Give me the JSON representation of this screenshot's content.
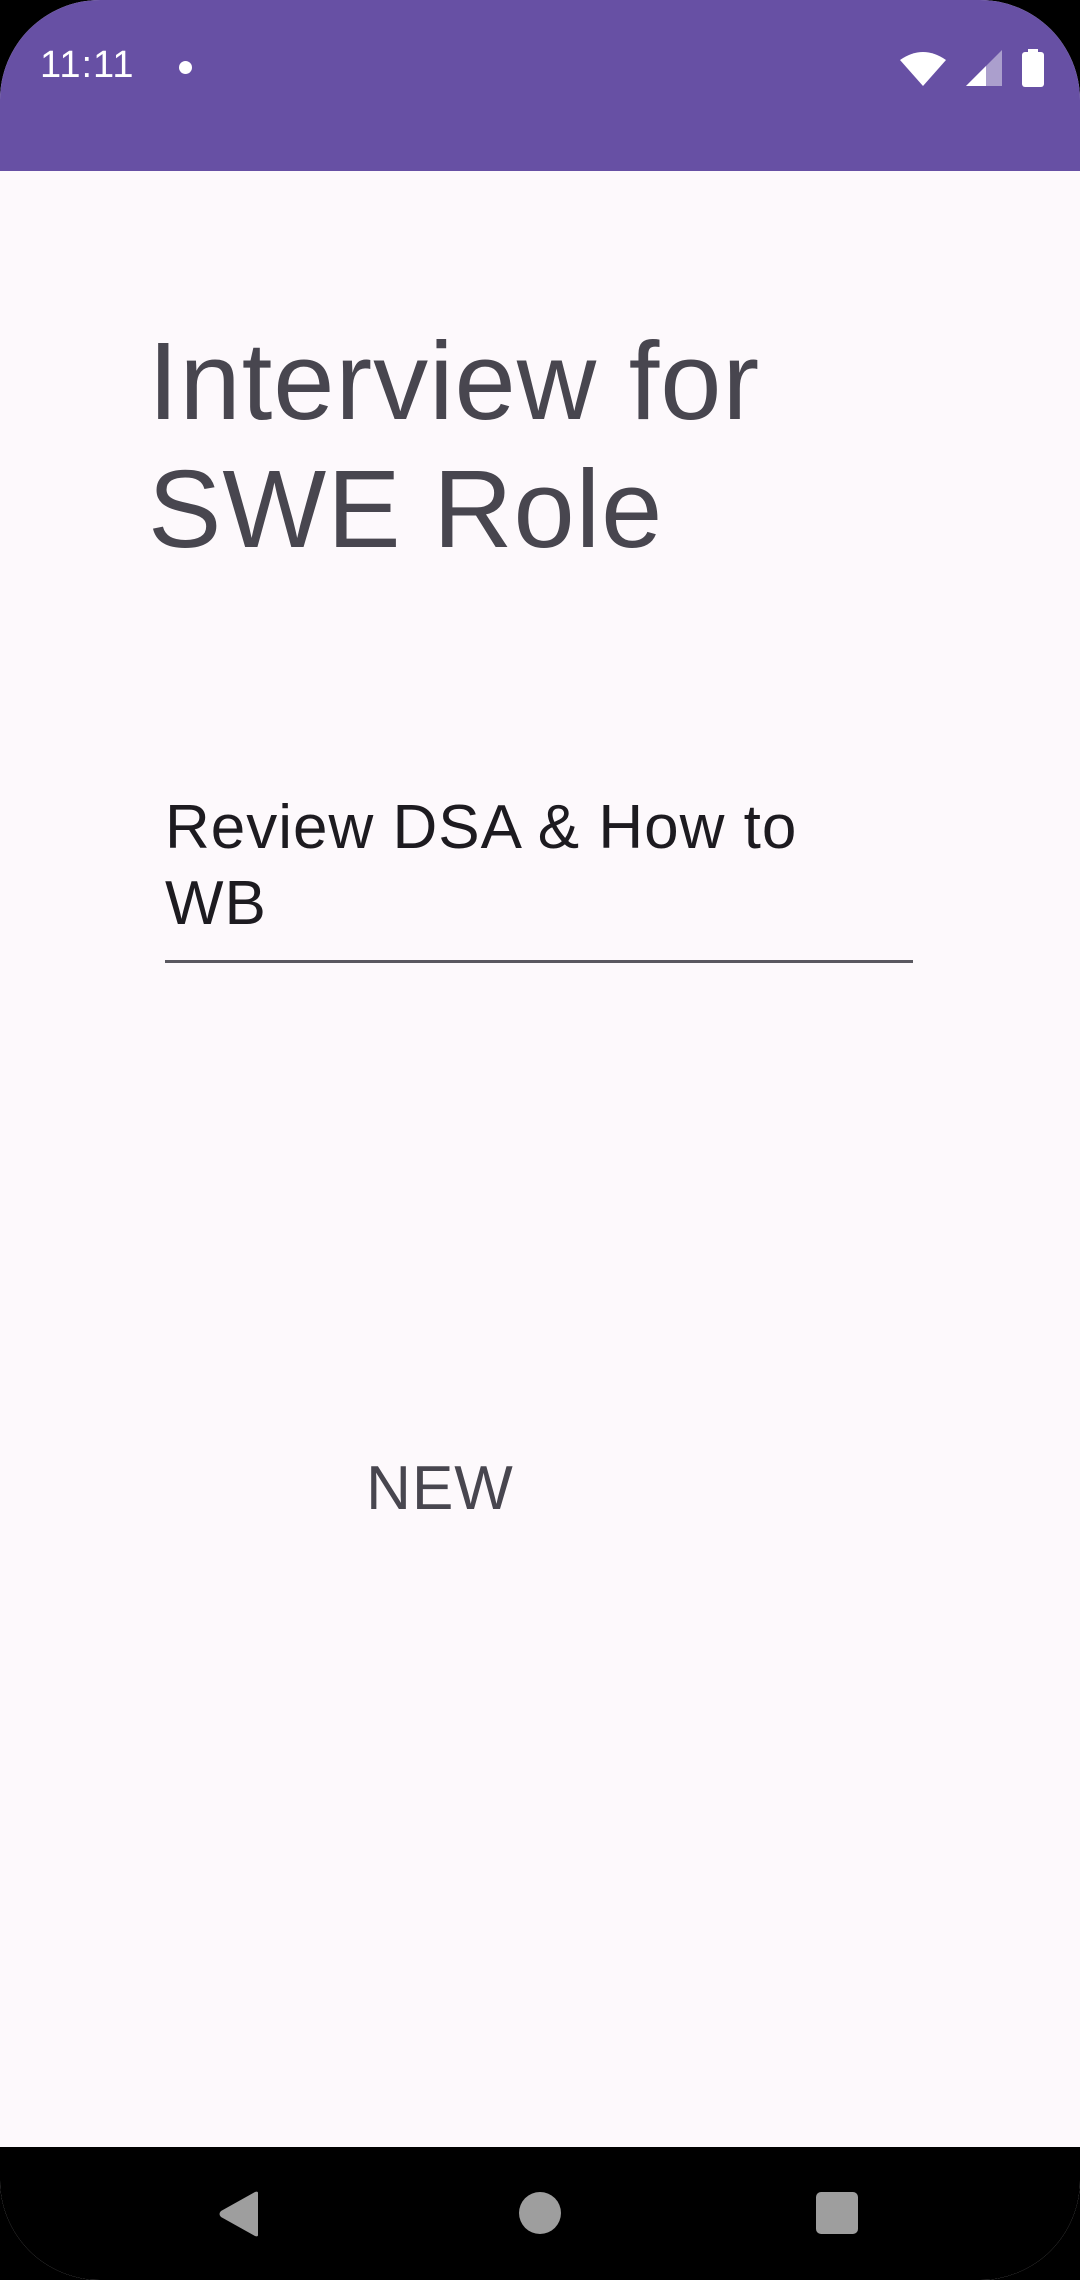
{
  "status_bar": {
    "time": "11:11",
    "background_color": "#6750a4",
    "icons": [
      "notification-dot-icon",
      "wifi-icon",
      "cellular-signal-icon",
      "battery-icon"
    ]
  },
  "screen": {
    "title": "Interview for SWE Role",
    "task_input": {
      "value": "Review DSA & How to WB",
      "placeholder": ""
    },
    "new_button_label": "NEW"
  },
  "nav_bar": {
    "icons": [
      "back-icon",
      "home-icon",
      "recents-icon"
    ]
  },
  "colors": {
    "accent": "#6750a4",
    "background": "#fdf9fc",
    "text": "#48464f"
  }
}
